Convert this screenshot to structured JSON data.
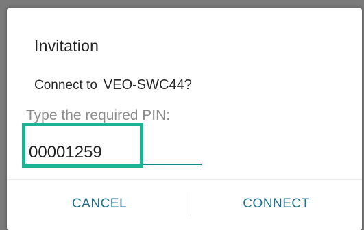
{
  "dialog": {
    "title": "Invitation",
    "message_prefix": "Connect to",
    "device_name": "VEO-SWC44?",
    "pin_label": "Type the required PIN:",
    "pin_value": "00001259",
    "cancel_label": "CANCEL",
    "connect_label": "CONNECT"
  },
  "colors": {
    "accent": "#0c8c86",
    "highlight": "#1ab394",
    "button_text": "#1f6f8c"
  }
}
